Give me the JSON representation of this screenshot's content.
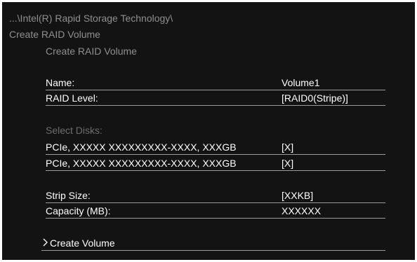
{
  "header": {
    "path": "...\\Intel(R) Rapid Storage Technology\\",
    "title": "Create RAID Volume",
    "subtitle": "Create RAID Volume"
  },
  "form": {
    "name": {
      "label": "Name:",
      "value": "Volume1"
    },
    "raid_level": {
      "label": "RAID Level:",
      "value": "[RAID0(Stripe)]"
    },
    "select_disks_label": "Select Disks:",
    "disks": [
      {
        "label": "PCIe, XXXXX XXXXXXXXX-XXXX, XXXGB",
        "value": "[X]"
      },
      {
        "label": "PCIe, XXXXX XXXXXXXXX-XXXX, XXXGB",
        "value": "[X]"
      }
    ],
    "strip_size": {
      "label": "Strip Size:",
      "value": "[XXKB]"
    },
    "capacity": {
      "label": "Capacity (MB):",
      "value": "XXXXXX"
    }
  },
  "actions": {
    "create_volume_label": "Create Volume",
    "chevron_icon": "chevron-right-icon"
  },
  "colors": {
    "background": "#131313",
    "header_text": "#8f8f8f",
    "section_label_text": "#6e6e6e",
    "item_text": "#ffffff",
    "divider": "#9c9c9c"
  }
}
